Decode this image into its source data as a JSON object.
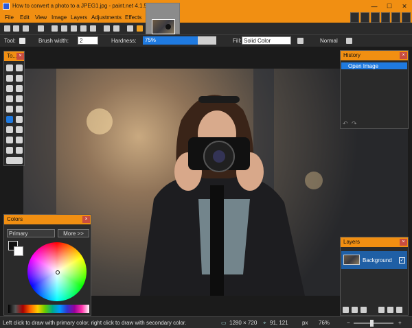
{
  "window": {
    "title": "How to convert a photo to a JPEG1.jpg - paint.net 4.1.5",
    "minimize": "—",
    "maximize": "☐",
    "close": "✕"
  },
  "menu": [
    "File",
    "Edit",
    "View",
    "Image",
    "Layers",
    "Adjustments",
    "Effects"
  ],
  "toolbar": {
    "tool_label": "Tool:",
    "brush_width_label": "Brush width:",
    "brush_width_value": "2",
    "hardness_label": "Hardness:",
    "hardness_value": "75%",
    "hardness_level": 0.75,
    "fill_label": "Fill:",
    "fill_value": "Solid Color",
    "blend_mode": "Normal"
  },
  "panels": {
    "tools": {
      "title": "To..."
    },
    "history": {
      "title": "History",
      "items": [
        "Open Image"
      ]
    },
    "colors": {
      "title": "Colors",
      "selector": "Primary",
      "more_button": "More >>"
    },
    "layers": {
      "title": "Layers",
      "items": [
        "Background"
      ]
    }
  },
  "status": {
    "hint": "Left click to draw with primary color, right click to draw with secondary color.",
    "image_size": "1280 × 720",
    "cursor_pos": "91, 121",
    "units": "px",
    "zoom": "76%"
  },
  "colors": {
    "accent": "#f18f12",
    "selection": "#1f7ae0",
    "panel_bg": "#2a2a2a",
    "close_red": "#c94d3f"
  },
  "icons": [
    "app-icon",
    "new-icon",
    "open-icon",
    "save-icon",
    "print-icon",
    "cut-icon",
    "copy-icon",
    "paste-icon",
    "crop-icon",
    "deselect-icon",
    "undo-icon",
    "redo-icon",
    "grid-icon",
    "ruler-icon",
    "paintbrush-icon",
    "antialias-icon",
    "opacity-icon",
    "undo-history-icon",
    "redo-history-icon",
    "layer-add-icon",
    "layer-delete-icon",
    "layer-duplicate-icon",
    "layer-up-icon",
    "layer-down-icon",
    "layer-properties-icon",
    "zoom-out-icon",
    "zoom-in-icon",
    "image-size-icon",
    "cursor-position-icon"
  ]
}
